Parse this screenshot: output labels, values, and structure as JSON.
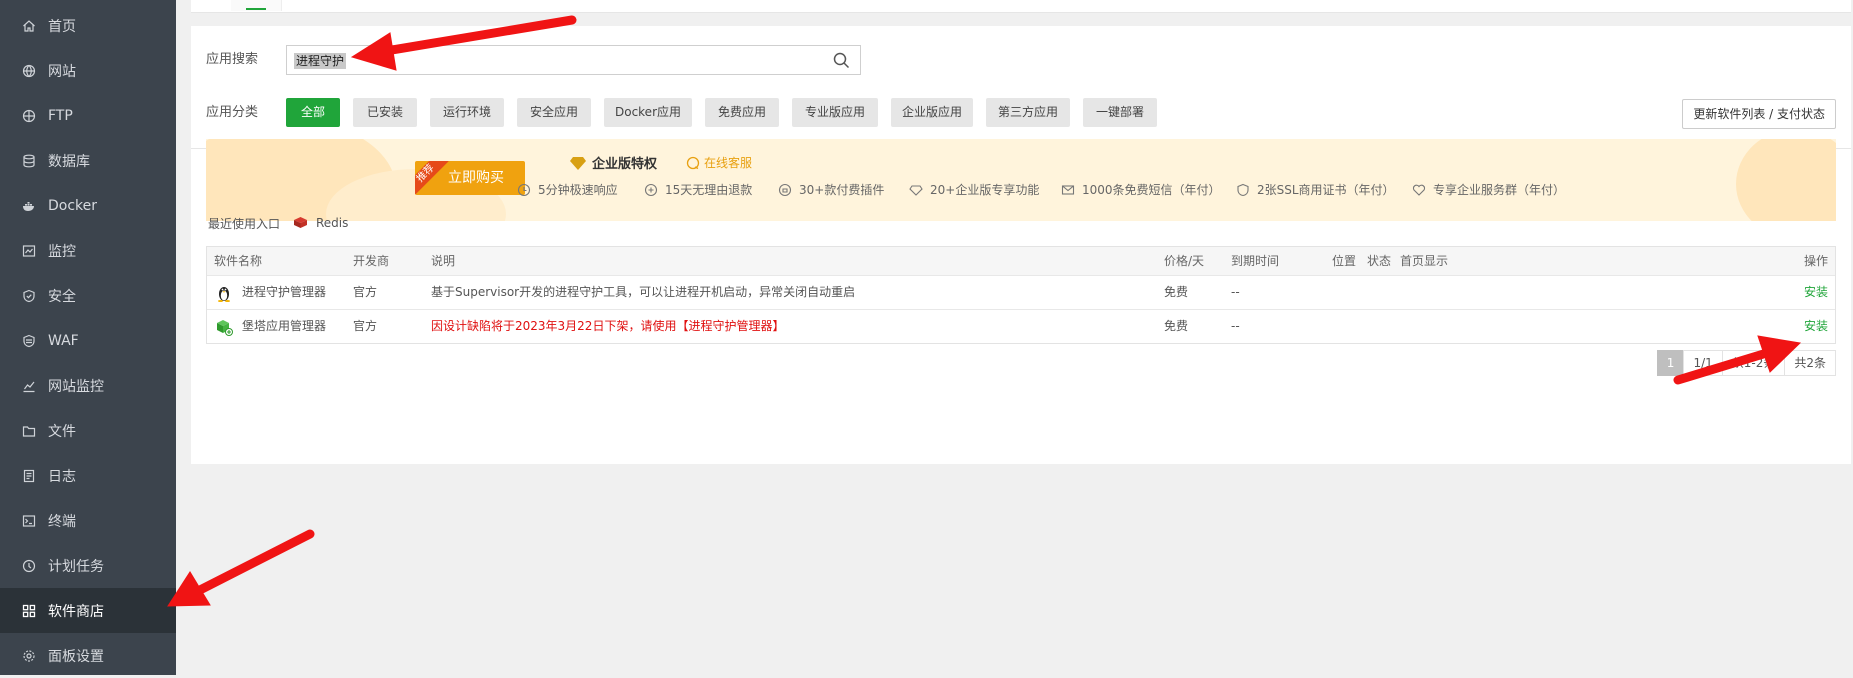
{
  "sidebar": {
    "items": [
      {
        "label": "首页",
        "icon": "home-icon"
      },
      {
        "label": "网站",
        "icon": "globe-icon"
      },
      {
        "label": "FTP",
        "icon": "ftp-icon"
      },
      {
        "label": "数据库",
        "icon": "database-icon"
      },
      {
        "label": "Docker",
        "icon": "docker-icon"
      },
      {
        "label": "监控",
        "icon": "monitor-icon"
      },
      {
        "label": "安全",
        "icon": "shield-icon"
      },
      {
        "label": "WAF",
        "icon": "waf-shield-icon"
      },
      {
        "label": "网站监控",
        "icon": "chart-icon"
      },
      {
        "label": "文件",
        "icon": "folder-icon"
      },
      {
        "label": "日志",
        "icon": "log-icon"
      },
      {
        "label": "终端",
        "icon": "terminal-icon"
      },
      {
        "label": "计划任务",
        "icon": "clock-icon"
      },
      {
        "label": "软件商店",
        "icon": "grid-icon",
        "active": true
      },
      {
        "label": "面板设置",
        "icon": "gear-icon"
      }
    ]
  },
  "search": {
    "label": "应用搜索",
    "value": "进程守护"
  },
  "category": {
    "label": "应用分类",
    "buttons": [
      "全部",
      "已安装",
      "运行环境",
      "安全应用",
      "Docker应用",
      "免费应用",
      "专业版应用",
      "企业版应用",
      "第三方应用",
      "一键部署"
    ],
    "refresh_label": "更新软件列表 / 支付状态"
  },
  "banner": {
    "ribbon": "推荐",
    "buy_label": "立即购买",
    "enterprise_title": "企业版特权",
    "customer_service": "在线客服",
    "features": [
      "5分钟极速响应",
      "15天无理由退款",
      "30+款付费插件",
      "20+企业版专享功能",
      "1000条免费短信（年付）",
      "2张SSL商用证书（年付）",
      "专享企业服务群（年付）"
    ]
  },
  "recent": {
    "label": "最近使用入口",
    "item": "Redis"
  },
  "table": {
    "headers": {
      "name": "软件名称",
      "developer": "开发商",
      "desc": "说明",
      "price": "价格/天",
      "expire": "到期时间",
      "position": "位置",
      "status": "状态",
      "homepage": "首页显示",
      "action": "操作"
    },
    "rows": [
      {
        "name": "进程守护管理器",
        "developer": "官方",
        "desc": "基于Supervisor开发的进程守护工具，可以让进程开机启动，异常关闭自动重启",
        "price": "免费",
        "expire": "--",
        "action": "安装"
      },
      {
        "name": "堡塔应用管理器",
        "developer": "官方",
        "desc": "因设计缺陷将于2023年3月22日下架，请使用【进程守护管理器】",
        "price": "免费",
        "expire": "--",
        "action": "安装"
      }
    ]
  },
  "pager": {
    "current": "1",
    "pages": "1/1",
    "range": "从1-2条",
    "total": "共2条"
  },
  "colors": {
    "accent": "#20a53a",
    "sidebar": "#3c444d",
    "warning": "#e01010",
    "annotation_arrow": "#f01010"
  }
}
